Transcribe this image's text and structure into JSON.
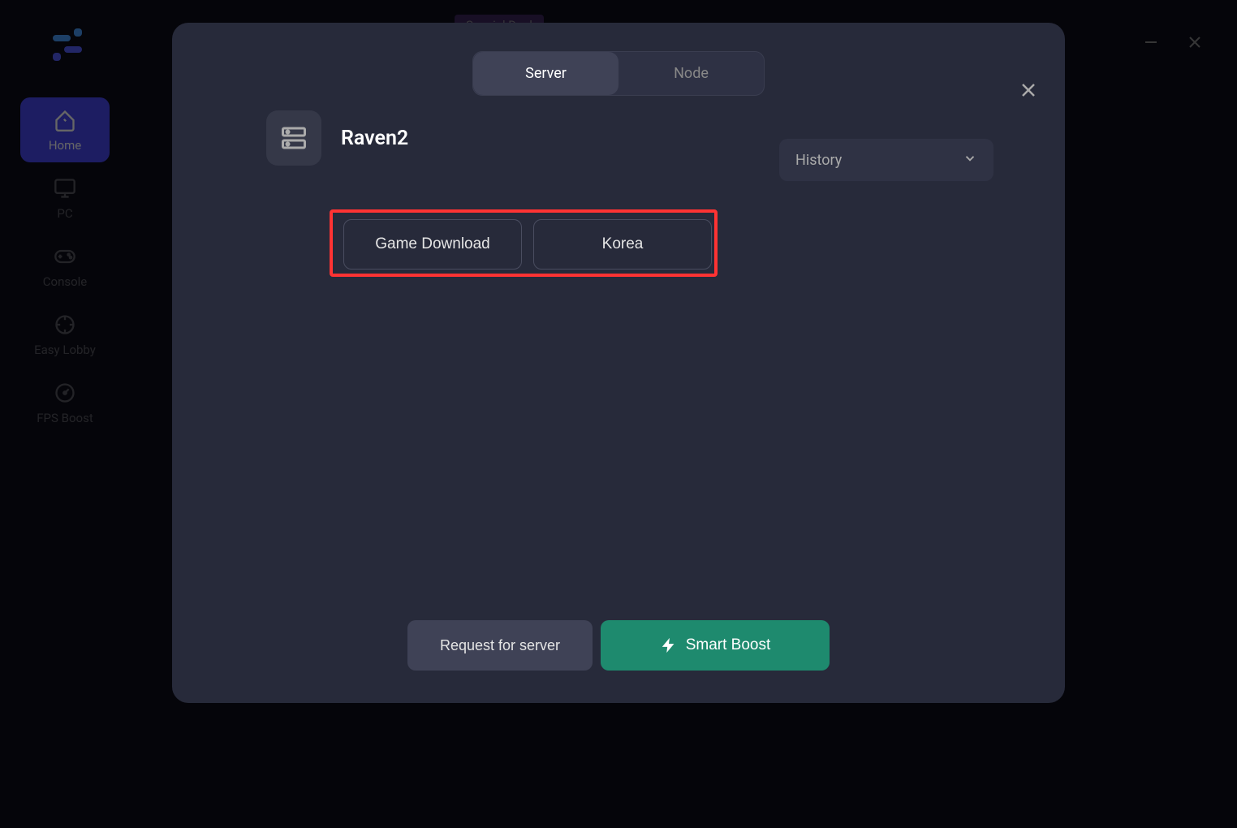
{
  "header": {
    "special_deal": "Special Deal"
  },
  "sidebar": {
    "items": [
      {
        "label": "Home"
      },
      {
        "label": "PC"
      },
      {
        "label": "Console"
      },
      {
        "label": "Easy Lobby"
      },
      {
        "label": "FPS Boost"
      }
    ]
  },
  "modal": {
    "tabs": {
      "server": "Server",
      "node": "Node"
    },
    "game_title": "Raven2",
    "history_label": "History",
    "server_options": [
      {
        "label": "Game Download"
      },
      {
        "label": "Korea"
      }
    ],
    "buttons": {
      "request": "Request for server",
      "boost": "Smart Boost"
    }
  }
}
